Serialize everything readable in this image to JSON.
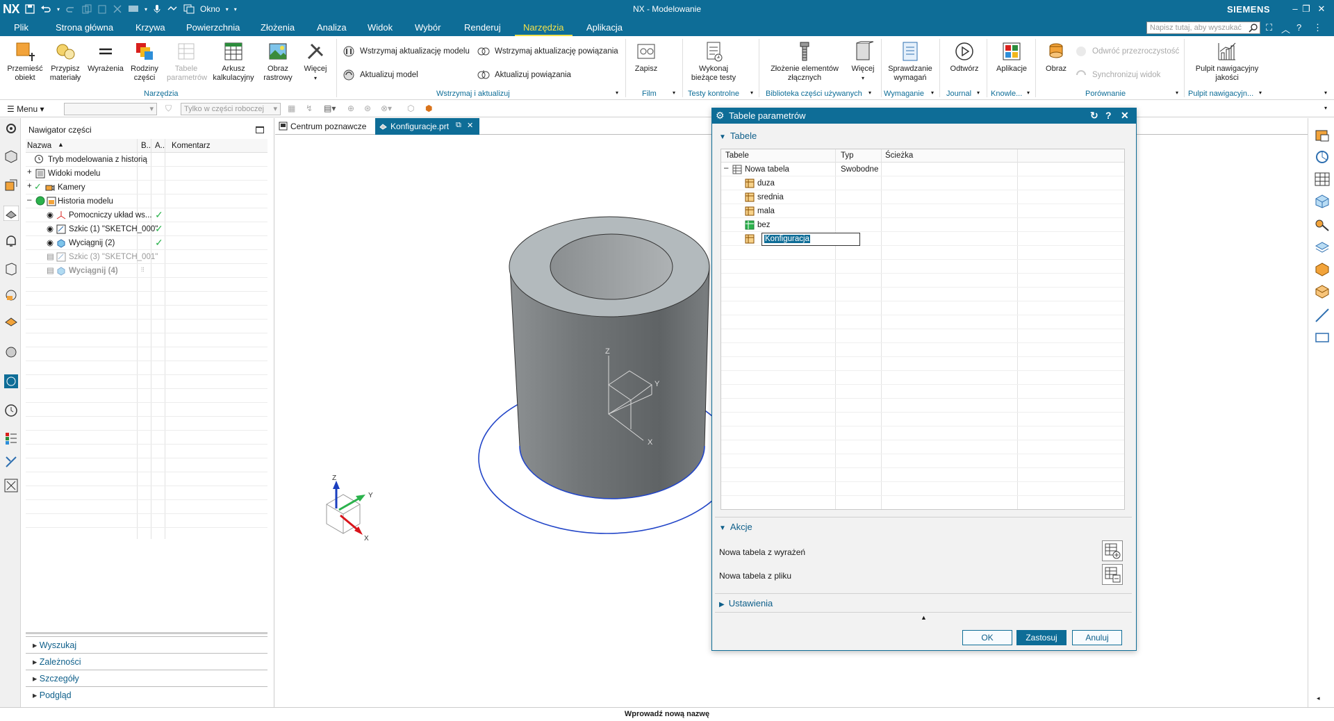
{
  "titlebar": {
    "app": "NX",
    "window_menu": "Okno",
    "title": "NX - Modelowanie",
    "brand": "SIEMENS"
  },
  "menu_tabs": [
    "Plik",
    "Strona główna",
    "Krzywa",
    "Powierzchnia",
    "Złożenia",
    "Analiza",
    "Widok",
    "Wybór",
    "Renderuj",
    "Narzędzia",
    "Aplikacja"
  ],
  "active_tab": "Narzędzia",
  "search": {
    "placeholder": "Napisz tutaj, aby wyszukać"
  },
  "ribbon": {
    "narzedzia": {
      "buttons": [
        "Przemieść obiekt",
        "Przypisz materiały",
        "Wyrażenia",
        "Rodziny części",
        "Tabele parametrów",
        "Arkusz kalkulacyjny",
        "Obraz rastrowy",
        "Więcej"
      ],
      "label": "Narzędzia"
    },
    "wstrzymaj": {
      "items": [
        "Wstrzymaj aktualizację modelu",
        "Wstrzymaj aktualizację powiązania",
        "Aktualizuj model",
        "Aktualizuj powiązania"
      ],
      "label": "Wstrzymaj i aktualizuj"
    },
    "film": {
      "button": "Zapisz",
      "label": "Film"
    },
    "testy": {
      "button": "Wykonaj bieżące testy",
      "label": "Testy kontrolne"
    },
    "biblioteka": {
      "buttons": [
        "Złożenie elementów złącznych",
        "Więcej"
      ],
      "label": "Biblioteka części używanych"
    },
    "wymaganie": {
      "button": "Sprawdzanie wymagań",
      "label": "Wymaganie"
    },
    "journal": {
      "button": "Odtwórz",
      "label": "Journal"
    },
    "knowledge": {
      "button": "Aplikacje",
      "label": "Knowle..."
    },
    "porownanie": {
      "button": "Obraz",
      "items": [
        "Odwróć przezroczystość",
        "Synchronizuj widok"
      ],
      "label": "Porównanie"
    },
    "pulpit": {
      "button": "Pulpit nawigacyjny jakości",
      "label": "Pulpit nawigacyjn..."
    }
  },
  "toolbar": {
    "menu": "Menu",
    "filter": "Tylko w części roboczej"
  },
  "navigator": {
    "title": "Nawigator części",
    "columns": [
      "Nazwa",
      "B..",
      "A..",
      "Komentarz"
    ],
    "rows": [
      {
        "name": "Tryb modelowania z historią",
        "check": ""
      },
      {
        "name": "Widoki modelu",
        "check": ""
      },
      {
        "name": "Kamery",
        "check": ""
      },
      {
        "name": "Historia modelu",
        "check": ""
      },
      {
        "name": "Pomocniczy układ ws...",
        "check": "✓"
      },
      {
        "name": "Szkic (1) \"SKETCH_000\"",
        "check": "✓"
      },
      {
        "name": "Wyciągnij (2)",
        "check": "✓"
      },
      {
        "name": "Szkic (3) \"SKETCH_001\"",
        "check": ""
      },
      {
        "name": "Wyciągnij (4)",
        "check": ""
      }
    ],
    "sections": [
      "Wyszukaj",
      "Zależności",
      "Szczegóły",
      "Podgląd"
    ]
  },
  "doc_tabs": [
    "Centrum poznawcze",
    "Konfiguracje.prt"
  ],
  "triad_labels": {
    "x": "X",
    "y": "Y",
    "z": "Z"
  },
  "dialog": {
    "title": "Tabele parametrów",
    "section_tables": "Tabele",
    "columns": [
      "Tabele",
      "Typ",
      "Ścieżka"
    ],
    "root": {
      "name": "Nowa tabela",
      "type": "Swobodne"
    },
    "children": [
      "duza",
      "srednia",
      "mala",
      "bez"
    ],
    "editing_value": "Konfiguracja",
    "section_actions": "Akcje",
    "actions": [
      "Nowa tabela z wyrażeń",
      "Nowa tabela z pliku"
    ],
    "section_settings": "Ustawienia",
    "buttons": {
      "ok": "OK",
      "apply": "Zastosuj",
      "cancel": "Anuluj"
    }
  },
  "status": "Wprowadź nową nazwę",
  "colors": {
    "accent": "#0e6d97",
    "highlight": "#f2e14a",
    "arrow": "#d9141b",
    "check": "#2bb24c"
  }
}
